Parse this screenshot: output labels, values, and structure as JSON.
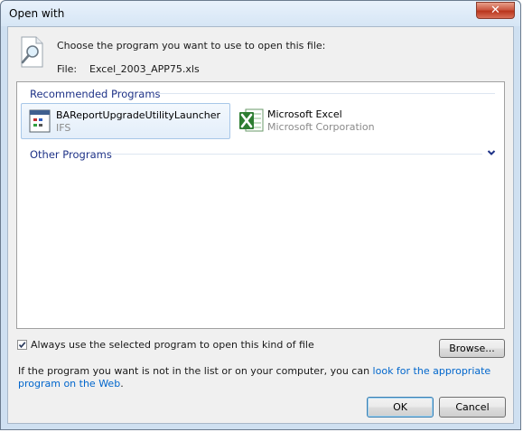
{
  "window": {
    "title": "Open with",
    "close_glyph": "✕"
  },
  "header": {
    "icon": "magnifier-document-icon",
    "prompt": "Choose the program you want to use to open this file:",
    "file_label": "File:",
    "file_name": "Excel_2003_APP75.xls"
  },
  "groups": {
    "recommended": "Recommended Programs",
    "other": "Other Programs"
  },
  "programs": [
    {
      "name": "BAReportUpgradeUtilityLauncher",
      "publisher": "IFS",
      "icon": "app-window-icon",
      "selected": true
    },
    {
      "name": "Microsoft Excel",
      "publisher": "Microsoft Corporation",
      "icon": "excel-icon",
      "selected": false
    }
  ],
  "options": {
    "always_use_label": "Always use the selected program to open this kind of file",
    "always_use_checked": true,
    "browse_label": "Browse..."
  },
  "help": {
    "text": "If the program you want is not in the list or on your computer, you can ",
    "link": "look for the appropriate program on the Web",
    "suffix": "."
  },
  "buttons": {
    "ok": "OK",
    "cancel": "Cancel"
  },
  "colors": {
    "link": "#0066cc",
    "group_header": "#1e3287",
    "selection": "#e3eefa"
  }
}
